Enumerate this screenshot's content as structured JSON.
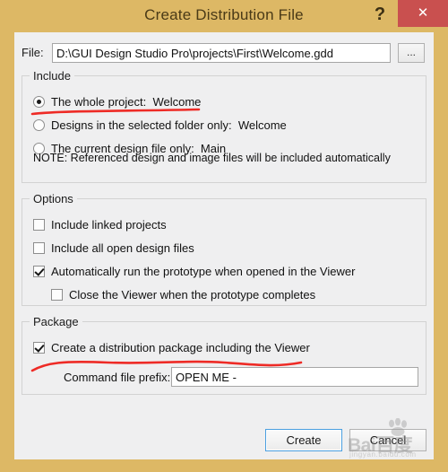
{
  "window": {
    "title": "Create Distribution File",
    "help_label": "?",
    "close_label": "✕"
  },
  "file": {
    "label": "File:",
    "value": "D:\\GUI Design Studio Pro\\projects\\First\\Welcome.gdd",
    "placeholder": "",
    "browse_label": "..."
  },
  "include": {
    "title": "Include",
    "options": [
      {
        "label": "The whole project:  Welcome",
        "checked": true
      },
      {
        "label": "Designs in the selected folder only:  Welcome",
        "checked": false
      },
      {
        "label": "The current design file only:  Main",
        "checked": false
      }
    ],
    "note": "NOTE: Referenced design and image files will be included automatically"
  },
  "options": {
    "title": "Options",
    "items": [
      {
        "label": "Include linked projects",
        "checked": false,
        "indent": false
      },
      {
        "label": "Include all open design files",
        "checked": false,
        "indent": false
      },
      {
        "label": "Automatically run the prototype when opened in the Viewer",
        "checked": true,
        "indent": false
      },
      {
        "label": "Close the Viewer when the prototype completes",
        "checked": false,
        "indent": true
      }
    ]
  },
  "package": {
    "title": "Package",
    "checkbox": {
      "label": "Create a distribution package including the Viewer",
      "checked": true
    },
    "prefix_label": "Command file prefix:",
    "prefix_value": "OPEN ME -",
    "prefix_placeholder": ""
  },
  "buttons": {
    "create": "Create",
    "cancel": "Cancel"
  },
  "watermark": {
    "brand": "Bai",
    "brand_cn": "百度",
    "sub": "jingyan.baidu.com"
  },
  "colors": {
    "titlebar": "#ddb865",
    "close_button": "#c9504f",
    "dialog_bg": "#efeff0",
    "annotation": "#ee2b26",
    "focus_border": "#4a9fe0"
  }
}
